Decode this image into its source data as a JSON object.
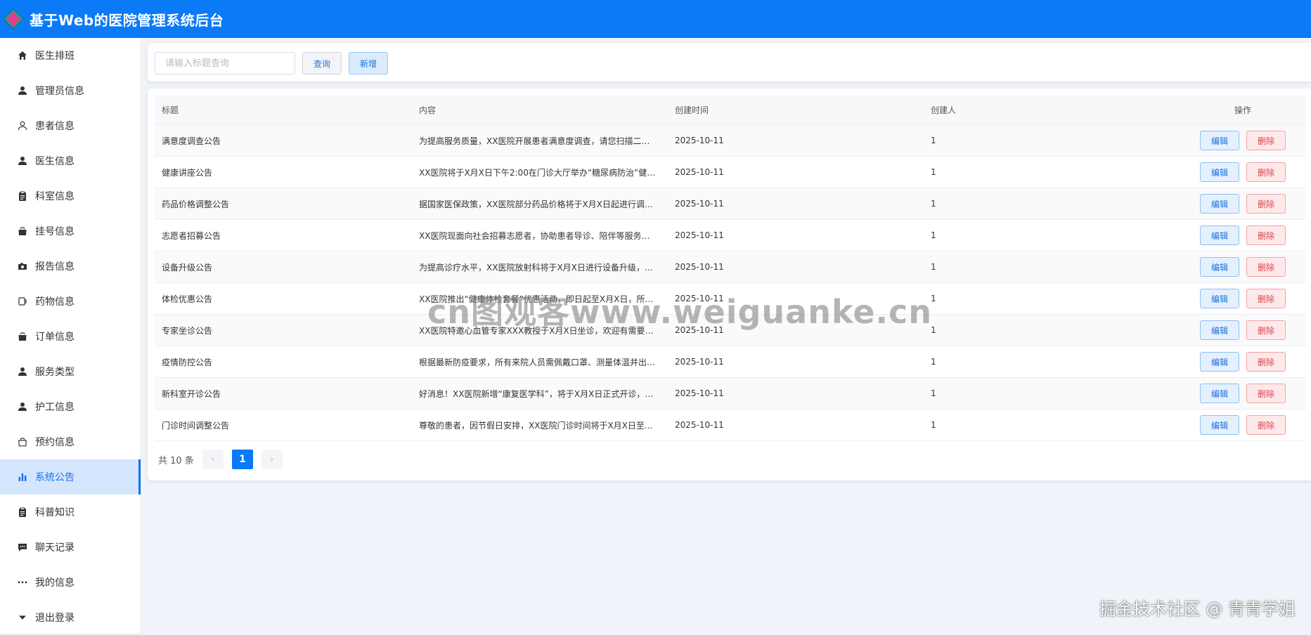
{
  "app": {
    "title": "基于Web的医院管理系统后台"
  },
  "sidebar": {
    "items": [
      {
        "label": "医生排班",
        "icon": "home-icon"
      },
      {
        "label": "管理员信息",
        "icon": "user-icon"
      },
      {
        "label": "患者信息",
        "icon": "user-outline-icon"
      },
      {
        "label": "医生信息",
        "icon": "user-icon"
      },
      {
        "label": "科室信息",
        "icon": "clipboard-icon"
      },
      {
        "label": "挂号信息",
        "icon": "bag-icon"
      },
      {
        "label": "报告信息",
        "icon": "camera-icon"
      },
      {
        "label": "药物信息",
        "icon": "cup-icon"
      },
      {
        "label": "订单信息",
        "icon": "bag-icon"
      },
      {
        "label": "服务类型",
        "icon": "user-icon"
      },
      {
        "label": "护工信息",
        "icon": "user-icon"
      },
      {
        "label": "预约信息",
        "icon": "bag-outline-icon"
      },
      {
        "label": "系统公告",
        "icon": "bar-chart-icon",
        "active": true
      },
      {
        "label": "科普知识",
        "icon": "clipboard-icon"
      },
      {
        "label": "聊天记录",
        "icon": "chat-icon"
      },
      {
        "label": "我的信息",
        "icon": "more-icon"
      },
      {
        "label": "退出登录",
        "icon": "caret-down-icon"
      }
    ]
  },
  "search": {
    "placeholder": "请输入标题查询",
    "value": "",
    "query_label": "查询",
    "add_label": "新增"
  },
  "table": {
    "headers": {
      "title": "标题",
      "content": "内容",
      "date": "创建时间",
      "creator": "创建人",
      "ops": "操作"
    },
    "edit_label": "编辑",
    "delete_label": "删除",
    "rows": [
      {
        "title": "满意度调查公告",
        "content": "为提高服务质量，XX医院开展患者满意度调查，请您扫描二维…",
        "date": "2025-10-11",
        "creator": "1"
      },
      {
        "title": "健康讲座公告",
        "content": "XX医院将于X月X日下午2:00在门诊大厅举办“糖尿病防治”健…",
        "date": "2025-10-11",
        "creator": "1"
      },
      {
        "title": "药品价格调整公告",
        "content": "据国家医保政策，XX医院部分药品价格将于X月X日起进行调整…",
        "date": "2025-10-11",
        "creator": "1"
      },
      {
        "title": "志愿者招募公告",
        "content": "XX医院现面向社会招募志愿者，协助患者导诊、陪伴等服务。…",
        "date": "2025-10-11",
        "creator": "1"
      },
      {
        "title": "设备升级公告",
        "content": "为提高诊疗水平，XX医院放射科将于X月X日进行设备升级，期…",
        "date": "2025-10-11",
        "creator": "1"
      },
      {
        "title": "体检优惠公告",
        "content": "XX医院推出“健康体检套餐”优惠活动，即日起至X月X日，所…",
        "date": "2025-10-11",
        "creator": "1"
      },
      {
        "title": "专家坐诊公告",
        "content": "XX医院特邀心血管专家XXX教授于X月X日坐诊，欢迎有需要的…",
        "date": "2025-10-11",
        "creator": "1"
      },
      {
        "title": "疫情防控公告",
        "content": "根据最新防疫要求，所有来院人员需佩戴口罩、测量体温并出…",
        "date": "2025-10-11",
        "creator": "1"
      },
      {
        "title": "新科室开诊公告",
        "content": "好消息！XX医院新增“康复医学科”，将于X月X日正式开诊，…",
        "date": "2025-10-11",
        "creator": "1"
      },
      {
        "title": "门诊时间调整公告",
        "content": "尊敬的患者，因节假日安排，XX医院门诊时间将于X月X日至X…",
        "date": "2025-10-11",
        "creator": "1"
      }
    ]
  },
  "pagination": {
    "total_label": "共 10 条",
    "current_page": "1",
    "prev": "‹",
    "next": "›"
  },
  "watermarks": {
    "center": "cn图观客www.weiguanke.cn",
    "corner": "掘金技术社区 @ 青青学姐"
  },
  "colors": {
    "header": "#0a7af6",
    "active_nav_bg": "#d4e6fd",
    "active_nav_text": "#1672ec",
    "delete": "#e0434d"
  }
}
